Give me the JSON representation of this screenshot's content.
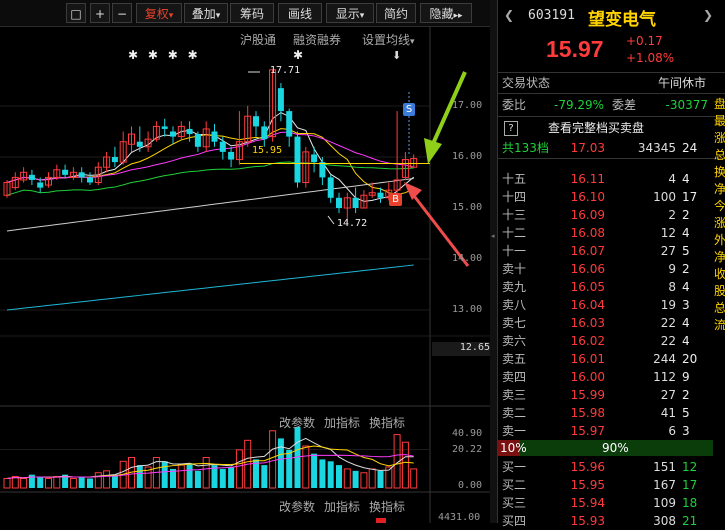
{
  "toolbar": {
    "items": [
      "□",
      "+",
      "−",
      "复权",
      "叠加",
      "筹码",
      "画线",
      "显示",
      "简约",
      "隐藏"
    ],
    "fuquan_arrow": "▾",
    "more_arrow": "▸▸"
  },
  "chart_toplinks": {
    "hugutong": "沪股通",
    "rongzi": "融资融券",
    "junxian": "设置均线"
  },
  "markers": {
    "stars": "✱ ✱  ✱   ✱",
    "star_right": "✱",
    "arrow_down": "⬇",
    "s_badge": "S",
    "b_badge": "B"
  },
  "annotations": {
    "high": "17.71",
    "low": "14.72",
    "ma": "15.95"
  },
  "price_axis": [
    "17.00",
    "16.00",
    "15.00",
    "14.00",
    "13.00"
  ],
  "price_axis_current": "12.65",
  "sub1": {
    "controls": [
      "改参数",
      "加指标",
      "换指标"
    ],
    "axis": [
      "40.90",
      "20.22",
      "0.00"
    ]
  },
  "sub2": {
    "controls": [
      "改参数",
      "加指标",
      "换指标"
    ],
    "axis_value": "4431.00"
  },
  "chart_data": {
    "type": "candlestick",
    "candles": [
      [
        15.25,
        15.5,
        15.55,
        15.2
      ],
      [
        15.4,
        15.6,
        15.7,
        15.35
      ],
      [
        15.55,
        15.7,
        15.8,
        15.5
      ],
      [
        15.65,
        15.55,
        15.75,
        15.45
      ],
      [
        15.5,
        15.4,
        15.6,
        15.3
      ],
      [
        15.45,
        15.6,
        15.7,
        15.4
      ],
      [
        15.6,
        15.75,
        15.85,
        15.55
      ],
      [
        15.75,
        15.65,
        15.85,
        15.6
      ],
      [
        15.6,
        15.7,
        15.8,
        15.55
      ],
      [
        15.7,
        15.6,
        15.8,
        15.5
      ],
      [
        15.6,
        15.5,
        15.7,
        15.45
      ],
      [
        15.5,
        15.8,
        15.9,
        15.45
      ],
      [
        15.8,
        16.0,
        16.1,
        15.7
      ],
      [
        16.0,
        15.9,
        16.2,
        15.8
      ],
      [
        15.9,
        16.3,
        16.5,
        15.85
      ],
      [
        16.25,
        16.45,
        16.6,
        16.1
      ],
      [
        16.3,
        16.2,
        16.6,
        16.1
      ],
      [
        16.2,
        16.35,
        16.5,
        16.1
      ],
      [
        16.35,
        16.6,
        16.7,
        16.3
      ],
      [
        16.6,
        16.55,
        16.75,
        16.4
      ],
      [
        16.5,
        16.4,
        16.6,
        16.25
      ],
      [
        16.4,
        16.6,
        16.7,
        16.35
      ],
      [
        16.55,
        16.45,
        16.7,
        16.3
      ],
      [
        16.45,
        16.2,
        16.5,
        16.1
      ],
      [
        16.2,
        16.55,
        16.7,
        16.1
      ],
      [
        16.5,
        16.3,
        16.65,
        16.2
      ],
      [
        16.3,
        16.1,
        16.4,
        15.95
      ],
      [
        16.1,
        15.95,
        16.2,
        15.8
      ],
      [
        15.95,
        16.3,
        16.9,
        15.85
      ],
      [
        16.3,
        16.8,
        17.0,
        16.2
      ],
      [
        16.8,
        16.6,
        16.9,
        16.4
      ],
      [
        16.6,
        16.35,
        16.7,
        16.2
      ],
      [
        16.4,
        17.71,
        17.71,
        16.3
      ],
      [
        17.35,
        16.9,
        17.45,
        16.7
      ],
      [
        16.9,
        16.4,
        16.95,
        16.2
      ],
      [
        16.4,
        15.5,
        16.5,
        15.4
      ],
      [
        15.5,
        16.1,
        16.2,
        15.4
      ],
      [
        16.05,
        15.9,
        16.2,
        15.7
      ],
      [
        15.9,
        15.6,
        16.0,
        15.45
      ],
      [
        15.6,
        15.2,
        15.65,
        15.1
      ],
      [
        15.2,
        15.0,
        15.3,
        14.9
      ],
      [
        15.0,
        15.2,
        15.3,
        14.72
      ],
      [
        15.2,
        15.0,
        15.4,
        14.9
      ],
      [
        15.0,
        15.25,
        15.35,
        15.0
      ],
      [
        15.25,
        15.3,
        15.5,
        15.2
      ],
      [
        15.3,
        15.2,
        15.4,
        15.1
      ],
      [
        15.2,
        15.35,
        15.5,
        15.15
      ],
      [
        15.35,
        15.55,
        16.9,
        15.3
      ],
      [
        15.6,
        15.95,
        16.1,
        15.55
      ],
      [
        15.8,
        15.97,
        16.05,
        15.8
      ]
    ],
    "ylim": [
      12.65,
      17.9
    ],
    "volume": [
      5,
      6,
      5,
      7,
      6,
      5,
      6,
      7,
      5,
      6,
      5,
      8,
      9,
      7,
      14,
      16,
      12,
      11,
      16,
      14,
      10,
      12,
      13,
      9,
      16,
      12,
      10,
      11,
      20,
      25,
      15,
      12,
      30,
      26,
      20,
      32,
      22,
      18,
      15,
      14,
      12,
      10,
      9,
      8,
      10,
      9,
      11,
      28,
      24,
      10
    ],
    "volume_ylim": [
      0,
      40.9
    ]
  },
  "panel": {
    "code": "603191",
    "name": "望变电气",
    "price": "15.97",
    "change": "+0.17",
    "change_pct": "+1.08%",
    "status_label": "交易状态",
    "status_value": "午间休市",
    "weibi_label": "委比",
    "weibi_value": "-79.29%",
    "weicha_label": "委差",
    "weicha_value": "-30377",
    "full_book_q": "?",
    "full_book_text": "查看完整档买卖盘",
    "total_label": "共133档",
    "total_price": "17.03",
    "total_vol": "34345",
    "total_cnt": "24",
    "asks": [
      {
        "label": "十五",
        "price": "16.11",
        "vol": "4",
        "cnt": "4"
      },
      {
        "label": "十四",
        "price": "16.10",
        "vol": "100",
        "cnt": "17"
      },
      {
        "label": "十三",
        "price": "16.09",
        "vol": "2",
        "cnt": "2"
      },
      {
        "label": "十二",
        "price": "16.08",
        "vol": "12",
        "cnt": "4"
      },
      {
        "label": "十一",
        "price": "16.07",
        "vol": "27",
        "cnt": "5"
      },
      {
        "label": "卖十",
        "price": "16.06",
        "vol": "9",
        "cnt": "2"
      },
      {
        "label": "卖九",
        "price": "16.05",
        "vol": "8",
        "cnt": "4"
      },
      {
        "label": "卖八",
        "price": "16.04",
        "vol": "19",
        "cnt": "3"
      },
      {
        "label": "卖七",
        "price": "16.03",
        "vol": "22",
        "cnt": "4"
      },
      {
        "label": "卖六",
        "price": "16.02",
        "vol": "22",
        "cnt": "4"
      },
      {
        "label": "卖五",
        "price": "16.01",
        "vol": "244",
        "cnt": "20"
      },
      {
        "label": "卖四",
        "price": "16.00",
        "vol": "112",
        "cnt": "9"
      },
      {
        "label": "卖三",
        "price": "15.99",
        "vol": "27",
        "cnt": "2"
      },
      {
        "label": "卖二",
        "price": "15.98",
        "vol": "41",
        "cnt": "5"
      },
      {
        "label": "卖一",
        "price": "15.97",
        "vol": "6",
        "cnt": "3"
      }
    ],
    "split_left": "10%",
    "split_right": "90%",
    "bids": [
      {
        "label": "买一",
        "price": "15.96",
        "vol": "151",
        "cnt": "12"
      },
      {
        "label": "买二",
        "price": "15.95",
        "vol": "167",
        "cnt": "17"
      },
      {
        "label": "买三",
        "price": "15.94",
        "vol": "109",
        "cnt": "18"
      },
      {
        "label": "买四",
        "price": "15.93",
        "vol": "308",
        "cnt": "21"
      }
    ],
    "edge_chars": [
      "盘",
      "最",
      "涨",
      "总",
      "换",
      "净",
      "今",
      "涨",
      "外",
      "净",
      "收",
      "股",
      "总",
      "流"
    ]
  }
}
